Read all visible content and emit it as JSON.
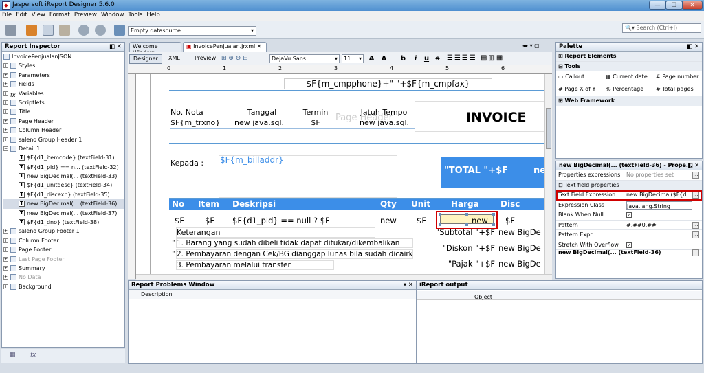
{
  "window": {
    "title": "Jaspersoft iReport Designer 5.6.0",
    "minimize": "—",
    "maximize": "❐",
    "close": "✕"
  },
  "menu": [
    "File",
    "Edit",
    "View",
    "Format",
    "Preview",
    "Window",
    "Tools",
    "Help"
  ],
  "toolbar": {
    "datasource": "Empty datasource",
    "search_placeholder": "Search (Ctrl+I)"
  },
  "inspector": {
    "title": "Report Inspector",
    "items": [
      {
        "label": "InvoicePenjualanJSON",
        "level": 0,
        "type": "root"
      },
      {
        "label": "Styles",
        "level": 1,
        "type": "folder"
      },
      {
        "label": "Parameters",
        "level": 1,
        "type": "folder"
      },
      {
        "label": "Fields",
        "level": 1,
        "type": "folder"
      },
      {
        "label": "Variables",
        "level": 1,
        "type": "fx"
      },
      {
        "label": "Scriptlets",
        "level": 1,
        "type": "folder"
      },
      {
        "label": "Title",
        "level": 1,
        "type": "band"
      },
      {
        "label": "Page Header",
        "level": 1,
        "type": "band"
      },
      {
        "label": "Column Header",
        "level": 1,
        "type": "band"
      },
      {
        "label": "saleno Group Header 1",
        "level": 1,
        "type": "band"
      },
      {
        "label": "Detail 1",
        "level": 1,
        "type": "band"
      },
      {
        "label": "$F{d1_itemcode} (textField-31)",
        "level": 2,
        "type": "text"
      },
      {
        "label": "$F{d1_pid} == n... (textField-32)",
        "level": 2,
        "type": "text"
      },
      {
        "label": "new BigDecimal(... (textField-33)",
        "level": 2,
        "type": "text"
      },
      {
        "label": "$F{d1_unitdesc} (textField-34)",
        "level": 2,
        "type": "text"
      },
      {
        "label": "$F{d1_discexp} (textField-35)",
        "level": 2,
        "type": "text"
      },
      {
        "label": "new BigDecimal(... (textField-36)",
        "level": 2,
        "type": "text",
        "selected": true
      },
      {
        "label": "new BigDecimal(... (textField-37)",
        "level": 2,
        "type": "text"
      },
      {
        "label": "$F{d1_dno} (textField-38)",
        "level": 2,
        "type": "text"
      },
      {
        "label": "saleno Group Footer 1",
        "level": 1,
        "type": "band"
      },
      {
        "label": "Column Footer",
        "level": 1,
        "type": "band"
      },
      {
        "label": "Page Footer",
        "level": 1,
        "type": "band"
      },
      {
        "label": "Last Page Footer",
        "level": 1,
        "type": "band",
        "gray": true
      },
      {
        "label": "Summary",
        "level": 1,
        "type": "band"
      },
      {
        "label": "No Data",
        "level": 1,
        "type": "band",
        "gray": true
      },
      {
        "label": "Background",
        "level": 1,
        "type": "band"
      }
    ]
  },
  "tabs": [
    {
      "label": "Welcome Window"
    },
    {
      "label": "InvoicePenjualan.jrxml"
    }
  ],
  "designer": {
    "modes": [
      "Designer",
      "XML",
      "Preview"
    ],
    "font": "DejaVu Sans",
    "size": "11",
    "fmt": [
      "b",
      "i",
      "u",
      "s"
    ]
  },
  "report": {
    "phone": "$F{m_cmpphone}+\" \"+$F{m_cmpfax}",
    "no_nota": "No. Nota",
    "tanggal": "Tanggal",
    "termin": "Termin",
    "jatuh_tempo": "Jatuh Tempo",
    "trxno": "$F{m_trxno}",
    "new_java1": "new java.sql.",
    "termin_f": "$F",
    "new_java2": "new java.sql.",
    "page_header_watermark": "Page Header",
    "invoice": "INVOICE",
    "kepada": "Kepada :",
    "billaddr": "$F{m_billaddr}",
    "total": "\"TOTAL \"+$F",
    "total_cut": "ne",
    "col_no": "No",
    "col_item": "Item",
    "col_desk": "Deskripsi",
    "col_qty": "Qty",
    "col_unit": "Unit",
    "col_harga": "Harga",
    "col_disc": "Disc",
    "d_f1": "$F",
    "d_f2": "$F",
    "d_pid": "$F{d1_pid} == null ? $F",
    "d_new1": "new",
    "d_f3": "$F",
    "d_new2": "new",
    "d_f4": "$F",
    "keterangan": "Keterangan",
    "note1": "1. Barang yang sudah dibeli tidak dapat ditukar/dikembalikan",
    "note2": "2. Pembayaran dengan Cek/BG dianggap lunas bila sudah dicairkan",
    "note3": "3. Pembayaran melalui transfer",
    "subtotal": "\"Subtotal \"+$F",
    "diskon": "\"Diskon \"+$F",
    "pajak": "\"Pajak \"+$F",
    "bigde1": "new BigDe",
    "bigde2": "new BigDe",
    "bigde3": "new BigDe",
    "q1": "\"",
    "q2": "\""
  },
  "palette": {
    "title": "Palette",
    "groups": [
      "Report Elements",
      "Tools",
      "Web Framework"
    ],
    "tools": [
      "Callout",
      "Current date",
      "Page number",
      "Page X of Y",
      "Percentage",
      "Total pages"
    ]
  },
  "properties": {
    "title": "new BigDecimal(... (textField-36) - Prope...",
    "rows": [
      {
        "name": "Properties expressions",
        "value": "No properties set",
        "dots": true
      },
      {
        "name": "Text field properties",
        "section": true
      },
      {
        "name": "Text Field Expression",
        "value": "new BigDecimal($F{d...",
        "dots": true,
        "highlight": true
      },
      {
        "name": "Expression Class",
        "value": "java.lang.String",
        "combo": true
      },
      {
        "name": "Blank When Null",
        "check": true
      },
      {
        "name": "Pattern",
        "value": "#,##0.##",
        "dots": true
      },
      {
        "name": "Pattern Expr.",
        "value": "",
        "dots": true
      },
      {
        "name": "Stretch With Overflow",
        "check": true
      }
    ],
    "footer": "new BigDecimal(... (textField-36)"
  },
  "problems": {
    "title": "Report Problems Window",
    "cols": [
      "Description",
      "Object"
    ]
  },
  "output": {
    "title": "iReport output"
  },
  "colors": {
    "band_header": "#3c8ee8",
    "total_bg": "#3c8ee8",
    "highlight": "#d00000"
  }
}
